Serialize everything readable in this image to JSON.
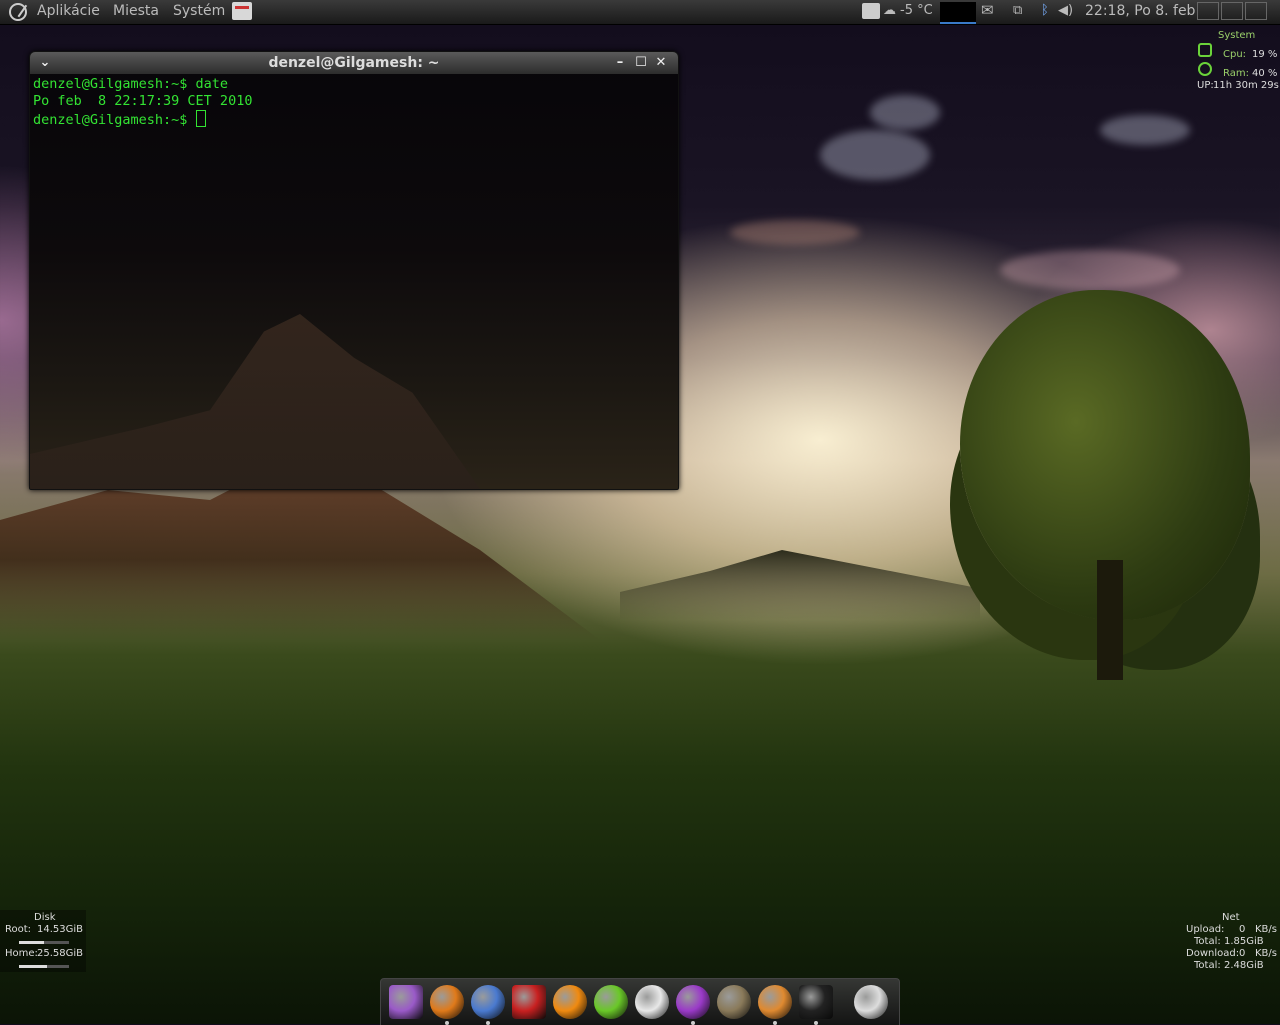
{
  "top_panel": {
    "menus": [
      "Aplikácie",
      "Miesta",
      "Systém"
    ],
    "temperature": "-5 °C",
    "clock": "22:18, Po  8. feb"
  },
  "terminal": {
    "title": "denzel@Gilgamesh: ~",
    "lines": [
      "denzel@Gilgamesh:~$ date",
      "Po feb  8 22:17:39 CET 2010",
      "denzel@Gilgamesh:~$ "
    ]
  },
  "conky_system": {
    "header": "System",
    "cpu_label": "Cpu:",
    "cpu_value": "19 %",
    "ram_label": "Ram:",
    "ram_value": "40 %",
    "uptime_label": "UP:",
    "uptime_value": "11h 30m 29s"
  },
  "conky_disk": {
    "header": "Disk",
    "root_label": "Root:",
    "root_value": "14.53GiB",
    "root_fill": 0.5,
    "home_label": "Home:",
    "home_value": "25.58GiB",
    "home_fill": 0.55
  },
  "conky_net": {
    "header": "Net",
    "upload_label": "Upload:",
    "upload_value": "0",
    "upload_unit": "KB/s",
    "upload_total_label": "Total:",
    "upload_total": "1.85GiB",
    "download_label": "Download:",
    "download_value": "0",
    "download_unit": "KB/s",
    "download_total_label": "Total:",
    "download_total": "2.48GiB"
  },
  "dock_icons": [
    {
      "name": "settings-icon",
      "color": "#9a5ac8"
    },
    {
      "name": "firefox-icon",
      "color": "#e07a1a"
    },
    {
      "name": "chromium-icon",
      "color": "#4a7ad0"
    },
    {
      "name": "tiles-icon",
      "color": "#c82020"
    },
    {
      "name": "vlc-icon",
      "color": "#f08a10"
    },
    {
      "name": "play-icon",
      "color": "#6ac828"
    },
    {
      "name": "chat-x-icon",
      "color": "#e8e8e8"
    },
    {
      "name": "alert-chat-icon",
      "color": "#9a3ac8"
    },
    {
      "name": "gimp-icon",
      "color": "#8a7a5a"
    },
    {
      "name": "nautilus-icon",
      "color": "#e08a30"
    },
    {
      "name": "terminal-icon",
      "color": "#222222"
    },
    {
      "name": "clock-icon",
      "color": "#dddddd"
    }
  ]
}
